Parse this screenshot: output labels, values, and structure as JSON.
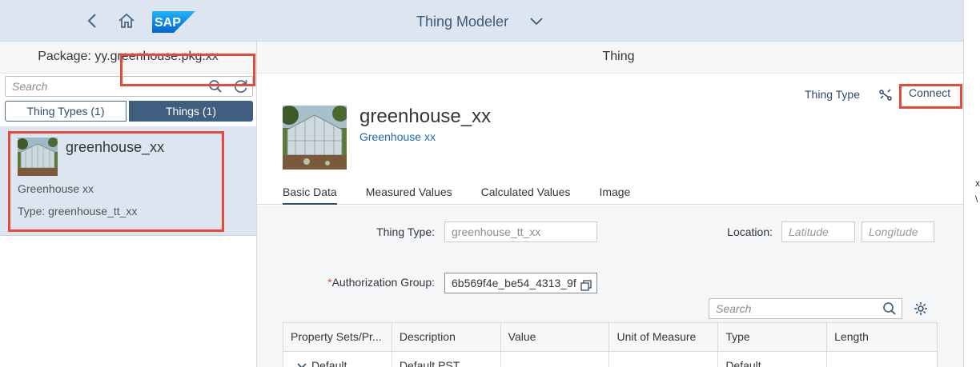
{
  "shell": {
    "title": "Thing Modeler",
    "logo_text": "SAP"
  },
  "master": {
    "package_title": "Package: yy.greenhouse.pkg.xx",
    "search_placeholder": "Search",
    "segments": [
      "Thing Types (1)",
      "Things (1)"
    ],
    "items": [
      {
        "name": "greenhouse_xx",
        "description": "Greenhouse xx",
        "type": "Type: greenhouse_tt_xx"
      }
    ]
  },
  "detail": {
    "header": "Thing",
    "thing_type_link": "Thing Type",
    "connect_label": "Connect",
    "title": "greenhouse_xx",
    "subtitle": "Greenhouse xx",
    "tabs": [
      "Basic Data",
      "Measured Values",
      "Calculated Values",
      "Image"
    ],
    "active_tab": "Basic Data",
    "form": {
      "thing_type_label": "Thing Type:",
      "thing_type_value": "greenhouse_tt_xx",
      "location_label": "Location:",
      "latitude_placeholder": "Latitude",
      "longitude_placeholder": "Longitude",
      "auth_required_mark": "*",
      "auth_label": "Authorization Group:",
      "auth_value": "6b569f4e_be54_4313_9f"
    },
    "table_search_placeholder": "Search",
    "table": {
      "columns": [
        "Property Sets/Pr...",
        "Description",
        "Value",
        "Unit of Measure",
        "Type",
        "Length"
      ],
      "rows": [
        [
          "Default",
          "Default PST",
          "",
          "",
          "Default",
          ""
        ]
      ]
    }
  },
  "edge": {
    "glyph1": "x",
    "glyph2": "\\"
  },
  "colors": {
    "shell_bg": "#dde6f0",
    "accent": "#3f5e80",
    "link": "#1c68b5",
    "highlight": "#e44b3a"
  },
  "icons": [
    "back-icon",
    "home-icon",
    "sap-logo",
    "chevron-down-icon",
    "search-icon",
    "refresh-icon",
    "connect-icon",
    "copy-icon",
    "gear-icon",
    "expand-chevron-icon"
  ]
}
